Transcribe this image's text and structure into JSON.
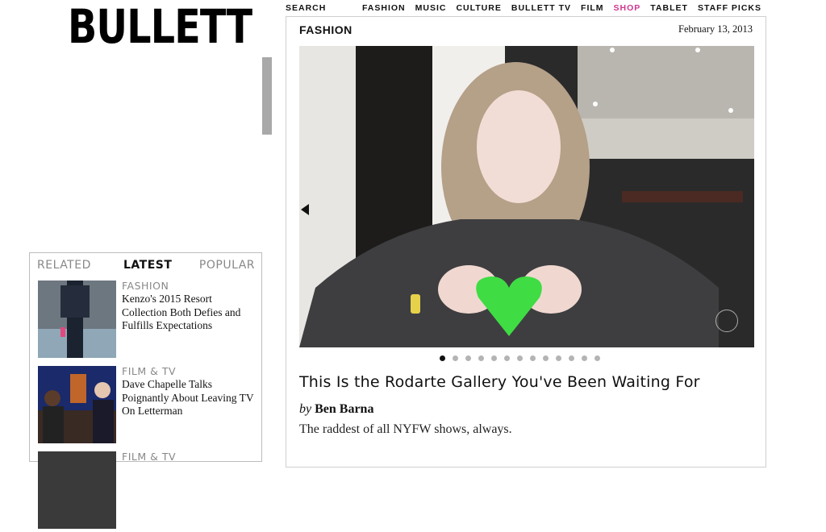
{
  "logo": "BULLETT",
  "nav": {
    "search": "SEARCH",
    "items": [
      "FASHION",
      "MUSIC",
      "CULTURE",
      "BULLETT TV",
      "FILM",
      "SHOP",
      "TABLET",
      "STAFF PICKS"
    ]
  },
  "colors": {
    "accent_shop": "#d0368f",
    "heart_green": "#3fdc44"
  },
  "article": {
    "section": "FASHION",
    "date": "February 13, 2013",
    "headline": "This Is the Rodarte Gallery You've Been Waiting For",
    "by": "by",
    "author": "Ben Barna",
    "dek": "The raddest of all NYFW shows, always.",
    "slides": {
      "count": 13,
      "current": 1
    }
  },
  "sidebar": {
    "tabs": [
      "RELATED",
      "LATEST",
      "POPULAR"
    ],
    "active_tab": "LATEST",
    "items": [
      {
        "category": "FASHION",
        "title": "Kenzo's 2015 Resort Collection Both Defies and Fulfills Expectations"
      },
      {
        "category": "FILM & TV",
        "title": "Dave Chapelle Talks Poignantly About Leaving TV On Letterman"
      },
      {
        "category": "FILM & TV",
        "title": ""
      }
    ]
  }
}
